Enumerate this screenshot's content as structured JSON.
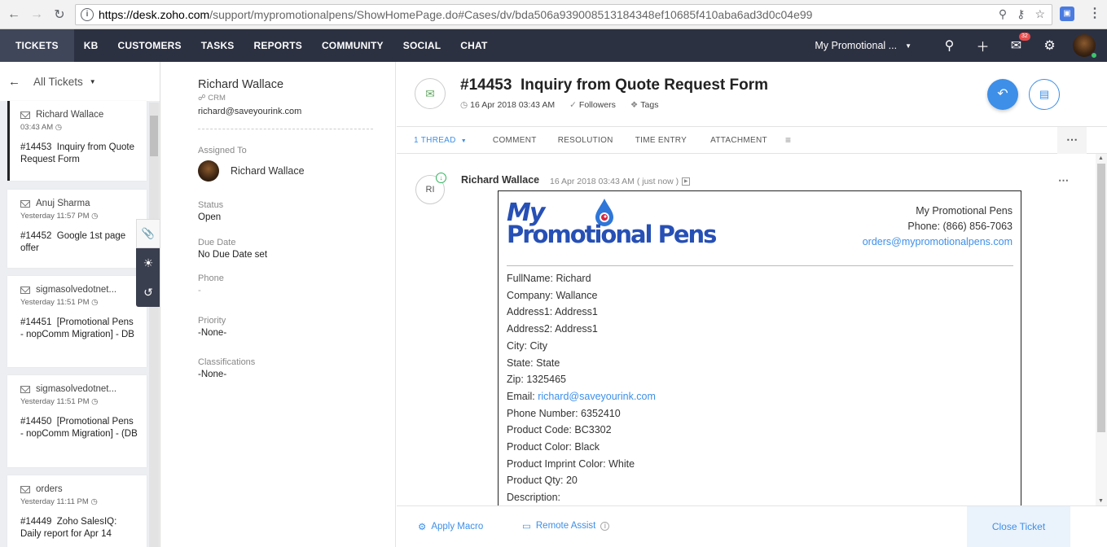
{
  "browser": {
    "url_host": "https://desk.zoho.com",
    "url_path": "/support/mypromotionalpens/ShowHomePage.do#Cases/dv/bda506a939008513184348ef10685f410aba6ad3d0c04e99"
  },
  "topnav": {
    "tabs": [
      "TICKETS",
      "KB",
      "CUSTOMERS",
      "TASKS",
      "REPORTS",
      "COMMUNITY",
      "SOCIAL",
      "CHAT"
    ],
    "department": "My Promotional ...",
    "notification_count": "32"
  },
  "list": {
    "view_title": "All Tickets",
    "tickets": [
      {
        "name": "Richard Wallace",
        "time": "03:43 AM",
        "number": "#14453",
        "subject": "Inquiry from Quote Request Form"
      },
      {
        "name": "Anuj Sharma",
        "time": "Yesterday 11:57 PM",
        "number": "#14452",
        "subject": "Google 1st page offer"
      },
      {
        "name": "sigmasolvedotnet...",
        "time": "Yesterday 11:51 PM",
        "number": "#14451",
        "subject": "[Promotional Pens - nopComm Migration] - DB"
      },
      {
        "name": "sigmasolvedotnet...",
        "time": "Yesterday 11:51 PM",
        "number": "#14450",
        "subject": "[Promotional Pens - nopComm Migration] - (DB"
      },
      {
        "name": "orders",
        "time": "Yesterday 11:11 PM",
        "number": "#14449",
        "subject": "Zoho SalesIQ: Daily report for Apr 14"
      }
    ]
  },
  "contact": {
    "name": "Richard Wallace",
    "source": "CRM",
    "email": "richard@saveyourink.com",
    "assigned_label": "Assigned To",
    "assigned_value": "Richard Wallace",
    "status_label": "Status",
    "status_value": "Open",
    "due_label": "Due Date",
    "due_value": "No Due Date set",
    "phone_label": "Phone",
    "phone_value": "-",
    "priority_label": "Priority",
    "priority_value": "-None-",
    "class_label": "Classifications",
    "class_value": "-None-"
  },
  "ticket": {
    "number": "#14453",
    "subject": "Inquiry from Quote Request Form",
    "date": "16 Apr 2018 03:43 AM",
    "followers": "Followers",
    "tags": "Tags",
    "tabs": {
      "thread": "1 THREAD",
      "comment": "COMMENT",
      "resolution": "RESOLUTION",
      "time_entry": "TIME ENTRY",
      "attachment": "ATTACHMENT"
    }
  },
  "thread": {
    "initials": "RI",
    "author": "Richard Wallace",
    "time": "16 Apr 2018 03:43 AM ( just now )"
  },
  "email": {
    "logo_line1": "My",
    "logo_line2": "Promotional Pens",
    "company_name": "My Promotional Pens",
    "company_phone": "Phone: (866) 856-7063",
    "company_email": "orders@mypromotionalpens.com",
    "fields": [
      {
        "label": "FullName:",
        "value": "Richard"
      },
      {
        "label": "Company:",
        "value": "Wallance"
      },
      {
        "label": "Address1:",
        "value": "Address1"
      },
      {
        "label": "Address2:",
        "value": "Address1"
      },
      {
        "label": "City:",
        "value": "City"
      },
      {
        "label": "State:",
        "value": "State"
      },
      {
        "label": "Zip:",
        "value": "1325465"
      },
      {
        "label": "Email:",
        "value": "richard@saveyourink.com",
        "link": true
      },
      {
        "label": "Phone Number:",
        "value": "6352410"
      },
      {
        "label": "Product Code:",
        "value": "BC3302"
      },
      {
        "label": "Product Color:",
        "value": "Black"
      },
      {
        "label": "Product Imprint Color:",
        "value": "White"
      },
      {
        "label": "Product Qty:",
        "value": "20"
      },
      {
        "label": "Description:",
        "value": ""
      }
    ]
  },
  "footer": {
    "apply_macro": "Apply Macro",
    "remote_assist": "Remote Assist",
    "close_ticket": "Close Ticket"
  },
  "colors": {
    "nav_bg": "#2c3142",
    "accent": "#3d8fe8",
    "logo_blue": "#2750b5"
  }
}
